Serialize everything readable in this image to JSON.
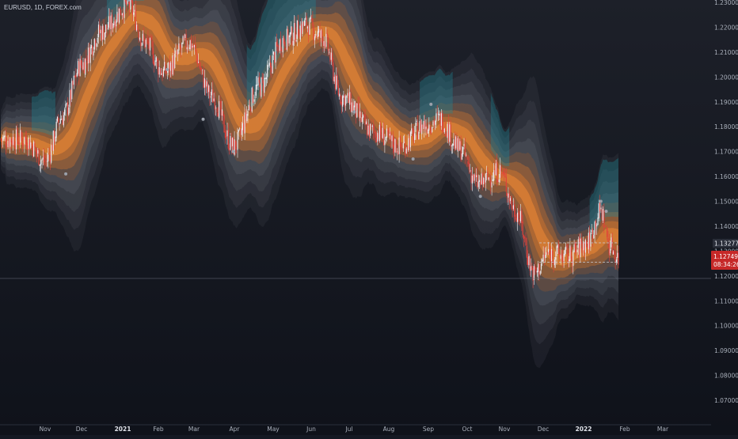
{
  "header": {
    "symbol_line": "EURUSD, 1D, FOREX.com"
  },
  "price_tags": {
    "upper": "1.13277",
    "last": "1.12749",
    "countdown": "08:34:26"
  },
  "colors": {
    "background": "#141822",
    "up_candle": "#e9edf3",
    "down_candle": "#e0413a",
    "band_core": "#d9782c",
    "band_teal": "#1d8a99",
    "band_grey": "#7b7f88",
    "axis_text": "#aab0bb",
    "last_price_tag": "#c62828"
  },
  "chart_data": {
    "type": "candlestick",
    "title": "",
    "symbol": "EURUSD",
    "interval": "1D",
    "source": "FOREX.com",
    "x_ticks": [
      "Nov",
      "Dec",
      "2021",
      "Feb",
      "Mar",
      "Apr",
      "May",
      "Jun",
      "Jul",
      "Aug",
      "Sep",
      "Oct",
      "Nov",
      "Dec",
      "2022",
      "Feb",
      "Mar"
    ],
    "y_ticks": [
      "1.23000",
      "1.22000",
      "1.21000",
      "1.20000",
      "1.19000",
      "1.18000",
      "1.17000",
      "1.16000",
      "1.15000",
      "1.14000",
      "1.13000",
      "1.12000",
      "1.11000",
      "1.10000",
      "1.09000",
      "1.08000",
      "1.07000"
    ],
    "ylim": [
      1.063,
      1.231
    ],
    "y_tick_values": [
      1.23,
      1.22,
      1.21,
      1.2,
      1.19,
      1.18,
      1.17,
      1.16,
      1.15,
      1.14,
      1.13,
      1.12,
      1.11,
      1.1,
      1.09,
      1.08,
      1.07
    ],
    "close_anchors": [
      {
        "date": "2020-10-15",
        "close": 1.175
      },
      {
        "date": "2020-11-01",
        "close": 1.166
      },
      {
        "date": "2020-11-15",
        "close": 1.184
      },
      {
        "date": "2020-12-01",
        "close": 1.205
      },
      {
        "date": "2020-12-15",
        "close": 1.218
      },
      {
        "date": "2021-01-06",
        "close": 1.229
      },
      {
        "date": "2021-01-20",
        "close": 1.214
      },
      {
        "date": "2021-02-05",
        "close": 1.202
      },
      {
        "date": "2021-02-25",
        "close": 1.214
      },
      {
        "date": "2021-03-15",
        "close": 1.192
      },
      {
        "date": "2021-03-31",
        "close": 1.172
      },
      {
        "date": "2021-04-20",
        "close": 1.196
      },
      {
        "date": "2021-05-10",
        "close": 1.215
      },
      {
        "date": "2021-05-28",
        "close": 1.221
      },
      {
        "date": "2021-06-10",
        "close": 1.216
      },
      {
        "date": "2021-06-25",
        "close": 1.192
      },
      {
        "date": "2021-07-20",
        "close": 1.178
      },
      {
        "date": "2021-08-10",
        "close": 1.172
      },
      {
        "date": "2021-08-30",
        "close": 1.181
      },
      {
        "date": "2021-09-10",
        "close": 1.183
      },
      {
        "date": "2021-09-25",
        "close": 1.171
      },
      {
        "date": "2021-10-10",
        "close": 1.157
      },
      {
        "date": "2021-10-28",
        "close": 1.162
      },
      {
        "date": "2021-11-10",
        "close": 1.146
      },
      {
        "date": "2021-11-24",
        "close": 1.121
      },
      {
        "date": "2021-12-05",
        "close": 1.129
      },
      {
        "date": "2021-12-20",
        "close": 1.128
      },
      {
        "date": "2022-01-03",
        "close": 1.133
      },
      {
        "date": "2022-01-14",
        "close": 1.146
      },
      {
        "date": "2022-01-21",
        "close": 1.132
      },
      {
        "date": "2022-01-28",
        "close": 1.127
      }
    ],
    "indicator": "moving average with standard deviation bands",
    "horizontal_levels": [
      1.1333,
      1.1255
    ],
    "last_price": 1.12749,
    "grid": false,
    "legend": "none"
  }
}
